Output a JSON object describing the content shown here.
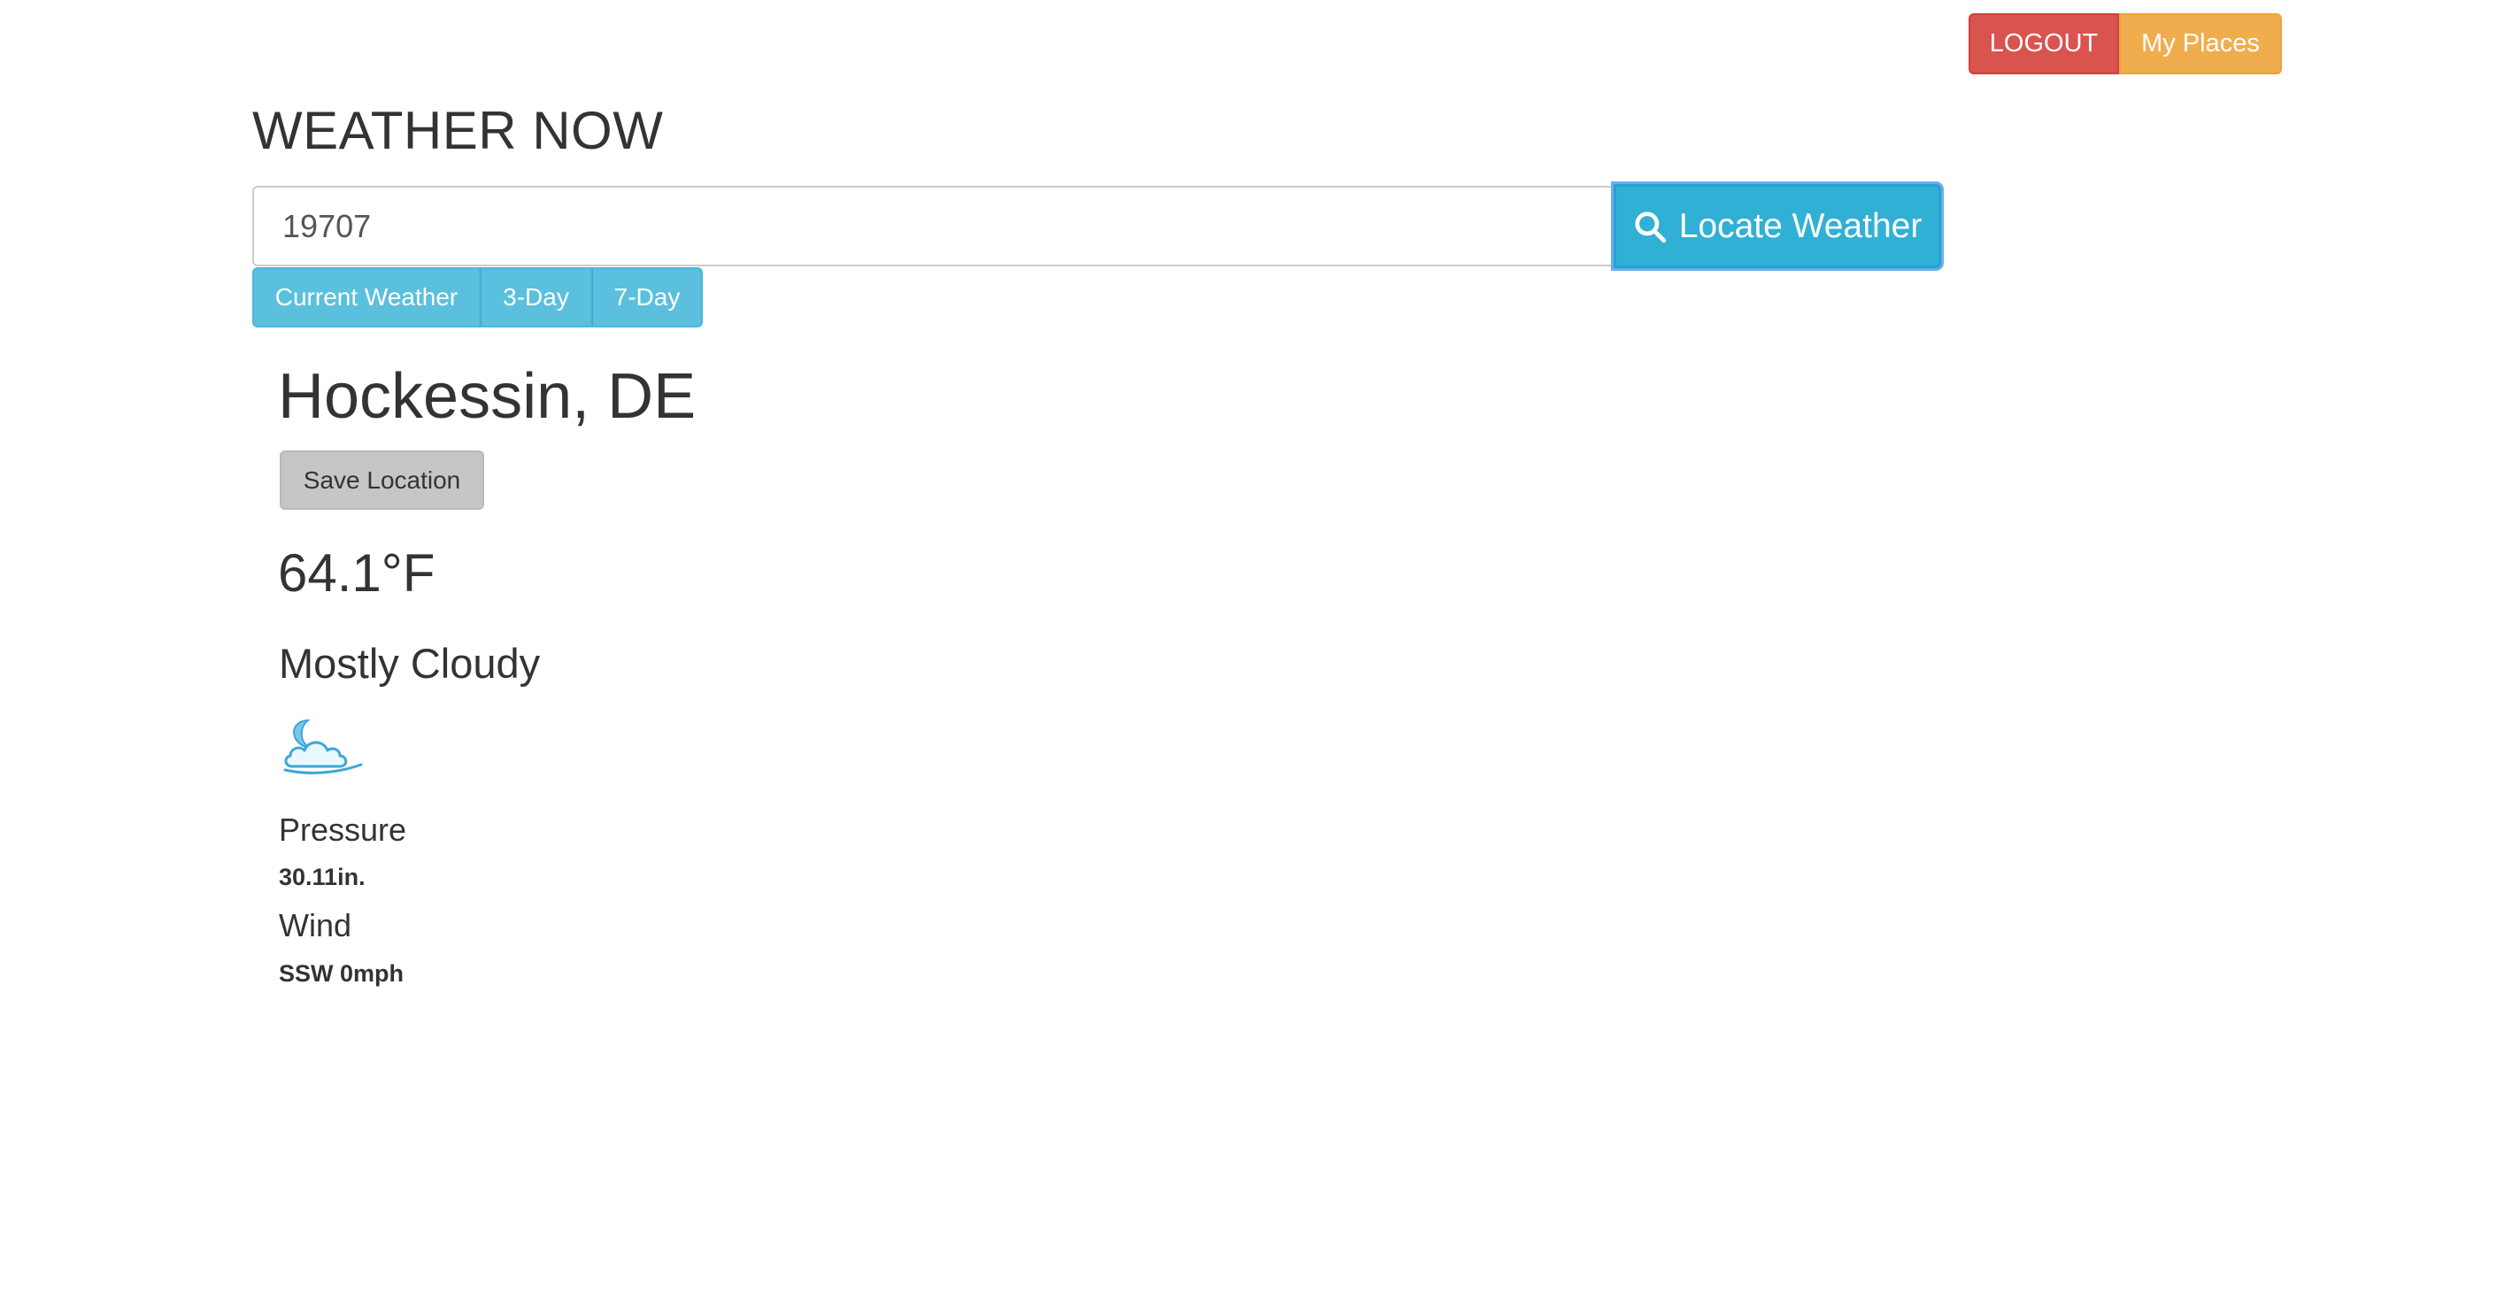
{
  "nav": {
    "logout_label": "LOGOUT",
    "my_places_label": "My Places",
    "colors": {
      "logout": "#d9534f",
      "my_places": "#f0ad4e"
    }
  },
  "header": {
    "title": "WEATHER NOW"
  },
  "search": {
    "value": "19707",
    "button_label": "Locate Weather",
    "button_icon": "search-icon",
    "button_color": "#31b0d5"
  },
  "tabs": [
    {
      "label": "Current Weather"
    },
    {
      "label": "3-Day"
    },
    {
      "label": "7-Day"
    }
  ],
  "weather": {
    "location": "Hockessin, DE",
    "save_label": "Save Location",
    "temperature": "64.1°F",
    "condition": "Mostly Cloudy",
    "condition_icon": "partly-cloudy-night-icon",
    "pressure_label": "Pressure",
    "pressure_value": "30.11in.",
    "wind_label": "Wind",
    "wind_value": "SSW 0mph"
  }
}
